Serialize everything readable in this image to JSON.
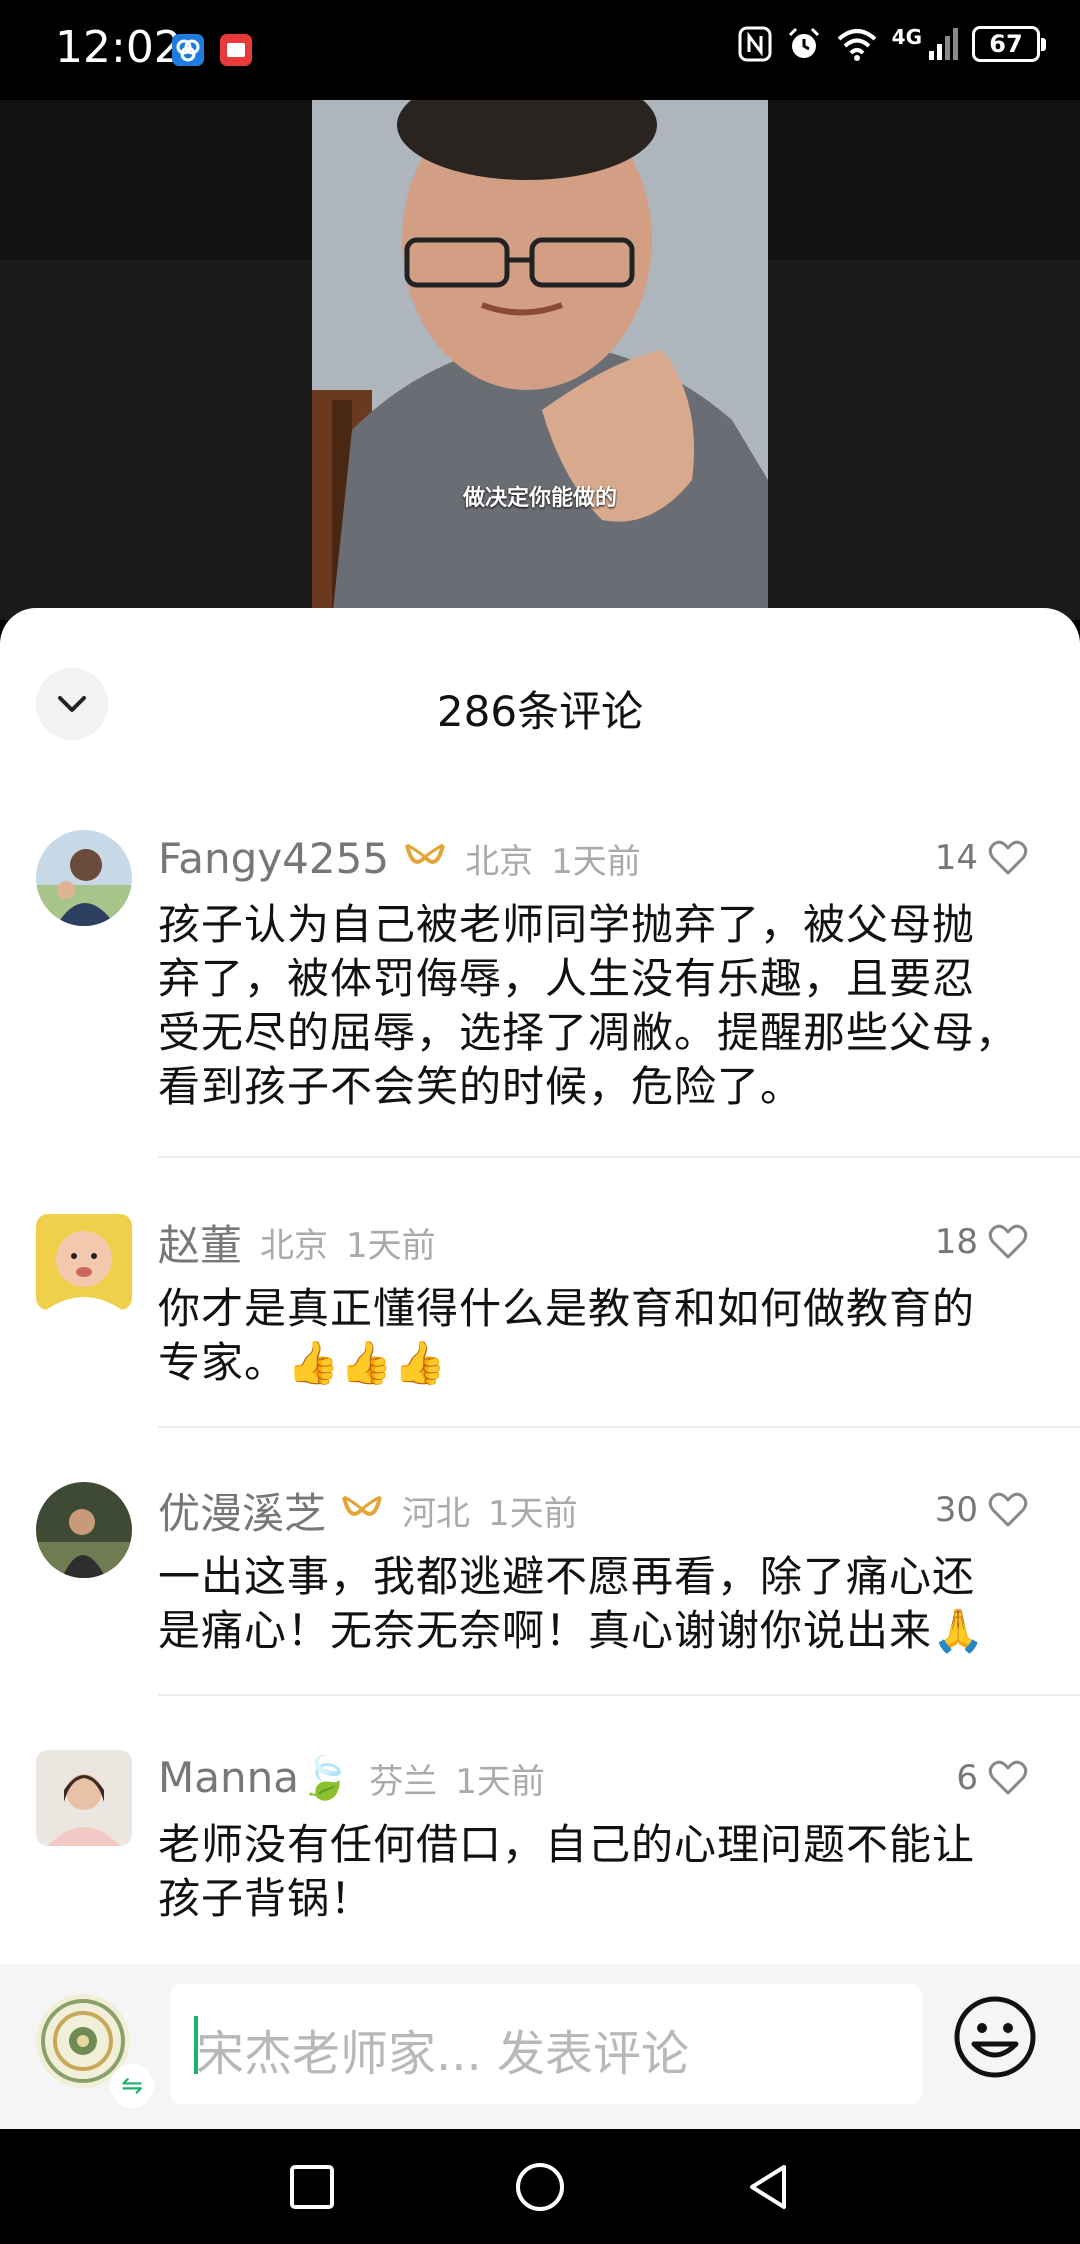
{
  "status_bar": {
    "time": "12:02",
    "battery": "67",
    "network": "4G",
    "icons": [
      "nfc-icon",
      "alarm-icon",
      "wifi-icon",
      "signal-icon",
      "battery-icon"
    ]
  },
  "video": {
    "caption": "做决定你能做的"
  },
  "comments_sheet": {
    "title": "286条评论",
    "comments": [
      {
        "name": "Fangy4255",
        "has_badge": true,
        "location": "北京",
        "time": "1天前",
        "likes": "14",
        "text_lines": [
          "孩子认为自己被老师同学抛弃了，被父母抛",
          "弃了，被体罚侮辱，人生没有乐趣，且要忍",
          "受无尽的屈辱，选择了凋敝。提醒那些父母，",
          "看到孩子不会笑的时候，危险了。"
        ]
      },
      {
        "name": "赵董",
        "has_badge": false,
        "location": "北京",
        "time": "1天前",
        "likes": "18",
        "text_lines": [
          "你才是真正懂得什么是教育和如何做教育的",
          "专家。👍👍👍"
        ]
      },
      {
        "name": "优漫溪芝",
        "has_badge": true,
        "location": "河北",
        "time": "1天前",
        "likes": "30",
        "text_lines": [
          "一出这事，我都逃避不愿再看，除了痛心还",
          "是痛心！无奈无奈啊！真心谢谢你说出来🙏"
        ]
      },
      {
        "name": "Manna🍃",
        "has_badge": false,
        "location": "芬兰",
        "time": "1天前",
        "likes": "6",
        "text_lines": [
          "老师没有任何借口，自己的心理问题不能让",
          "孩子背锅！"
        ]
      }
    ]
  },
  "input_bar": {
    "placeholder": "宋杰老师家... 发表评论",
    "switch_glyph": "⇋"
  },
  "colors": {
    "accent_green": "#1bb36a",
    "badge_gold": "#e3a538"
  }
}
